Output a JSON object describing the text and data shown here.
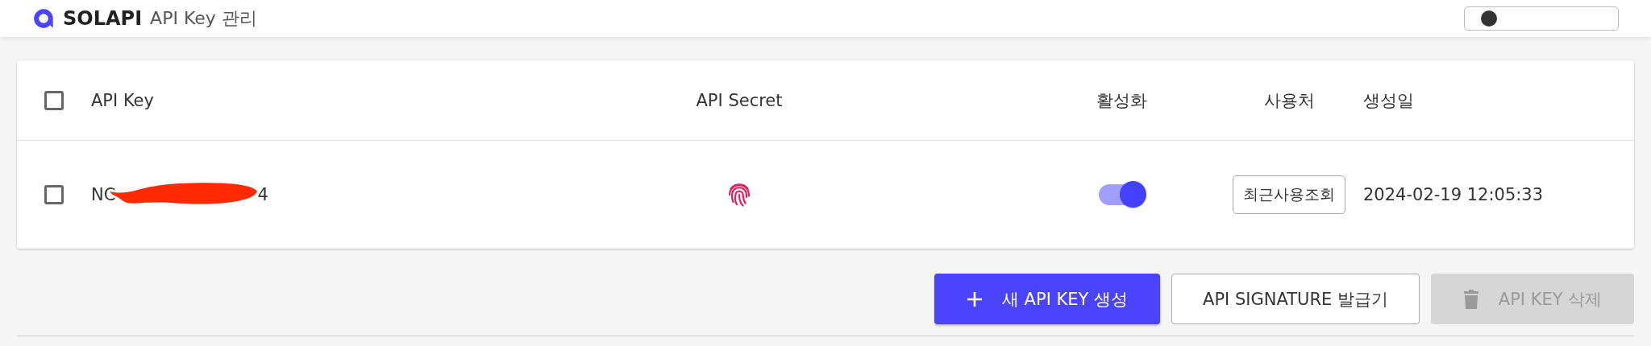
{
  "header": {
    "logo": "SOLAPI",
    "title": "API Key 관리"
  },
  "table": {
    "columns": [
      {
        "label": "API Key",
        "kind": "key"
      },
      {
        "label": "API Secret",
        "kind": "secret"
      },
      {
        "label": "활성화",
        "kind": "active"
      },
      {
        "label": "사용처",
        "kind": "usage"
      },
      {
        "label": "생성일",
        "kind": "date"
      }
    ],
    "select_all": {
      "checked": false
    },
    "rows": [
      {
        "checked": false,
        "key_start": "NC",
        "key_end": "4",
        "active": true,
        "usage_button": "최근사용조회",
        "created": "2024-02-19 12:05:33"
      }
    ]
  },
  "actions": [
    {
      "kind": "primary",
      "label": "새 API KEY 생성",
      "disabled": false
    },
    {
      "kind": "outline",
      "label": "API SIGNATURE 발급기",
      "disabled": false
    },
    {
      "kind": "delete",
      "label": "API KEY 삭제",
      "disabled": true
    }
  ]
}
